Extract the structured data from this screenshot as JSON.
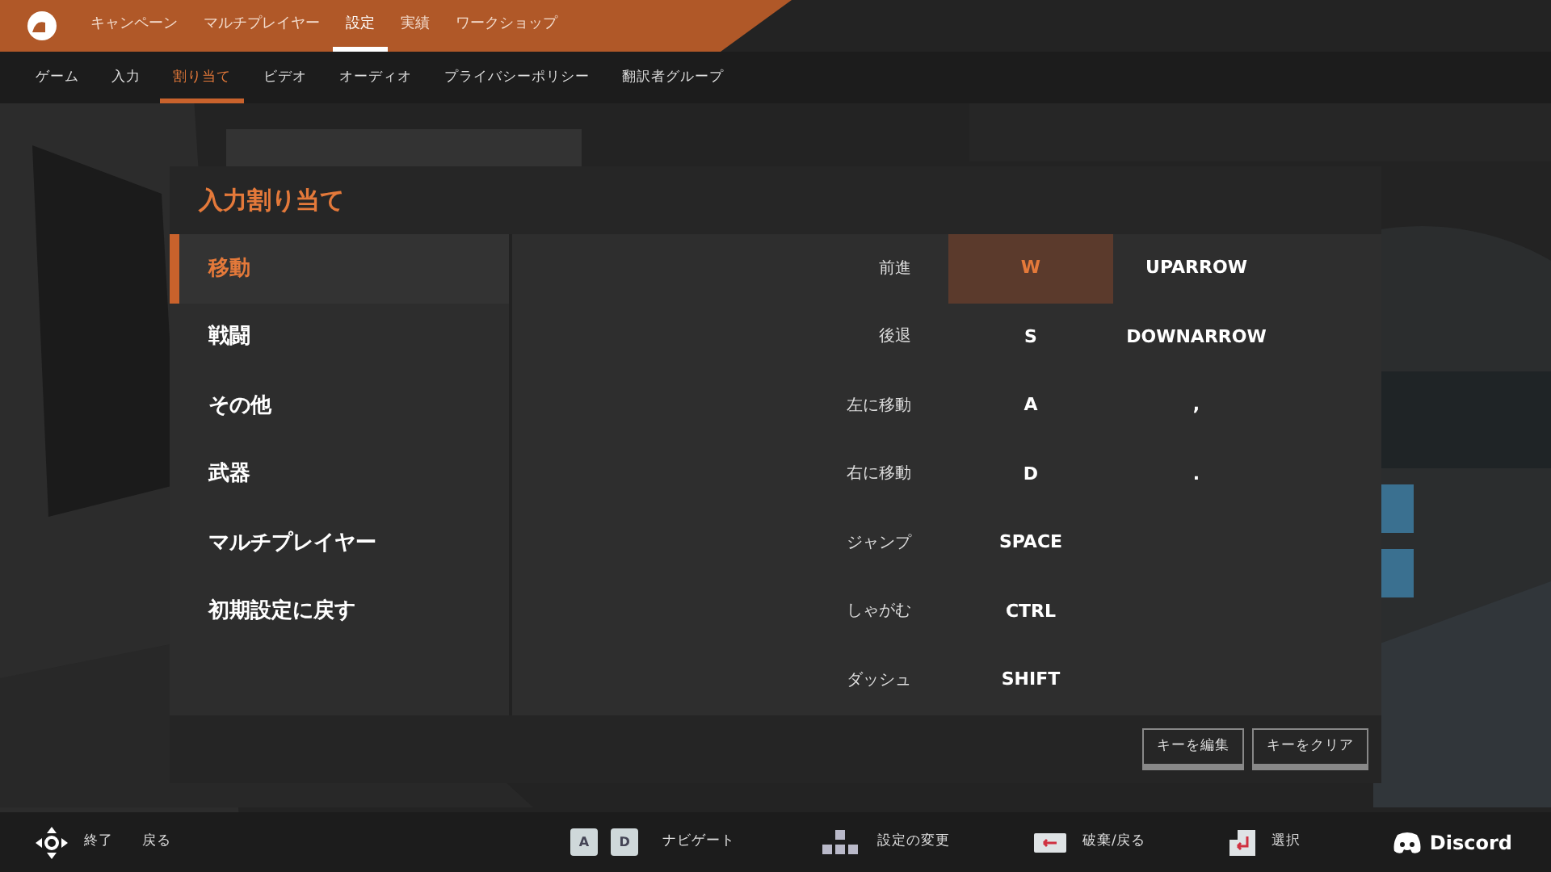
{
  "top_nav": [
    {
      "label": "キャンペーン",
      "selected": false
    },
    {
      "label": "マルチプレイヤー",
      "selected": false
    },
    {
      "label": "設定",
      "selected": true
    },
    {
      "label": "実績",
      "selected": false
    },
    {
      "label": "ワークショップ",
      "selected": false
    }
  ],
  "sub_nav": [
    {
      "label": "ゲーム",
      "selected": false
    },
    {
      "label": "入力",
      "selected": false
    },
    {
      "label": "割り当て",
      "selected": true
    },
    {
      "label": "ビデオ",
      "selected": false
    },
    {
      "label": "オーディオ",
      "selected": false
    },
    {
      "label": "プライバシーポリシー",
      "selected": false
    },
    {
      "label": "翻訳者グループ",
      "selected": false
    }
  ],
  "panel": {
    "title": "入力割り当て",
    "categories": [
      {
        "label": "移動",
        "selected": true
      },
      {
        "label": "戦闘",
        "selected": false
      },
      {
        "label": "その他",
        "selected": false
      },
      {
        "label": "武器",
        "selected": false
      },
      {
        "label": "マルチプレイヤー",
        "selected": false
      },
      {
        "label": "初期設定に戻す",
        "selected": false
      }
    ],
    "bindings": [
      {
        "action": "前進",
        "primary": "W",
        "secondary": "UPARROW",
        "selected": true
      },
      {
        "action": "後退",
        "primary": "S",
        "secondary": "DOWNARROW",
        "selected": false
      },
      {
        "action": "左に移動",
        "primary": "A",
        "secondary": ",",
        "selected": false
      },
      {
        "action": "右に移動",
        "primary": "D",
        "secondary": ".",
        "selected": false
      },
      {
        "action": "ジャンプ",
        "primary": "SPACE",
        "selected": false
      },
      {
        "action": "しゃがむ",
        "primary": "CTRL",
        "selected": false
      },
      {
        "action": "ダッシュ",
        "primary": "SHIFT",
        "selected": false
      }
    ],
    "buttons": [
      "キーを編集",
      "キーをクリア"
    ]
  },
  "footer": {
    "hints": [
      {
        "kind": "dpad",
        "label": "終了"
      },
      {
        "kind": "plain",
        "label": "戻る"
      },
      {
        "kind": "keys",
        "keys": [
          "A",
          "D"
        ],
        "label": "ナビゲート"
      },
      {
        "kind": "arrows",
        "label": "設定の変更"
      },
      {
        "kind": "backspace",
        "label": "破棄/戻る"
      },
      {
        "kind": "enter",
        "label": "選択"
      }
    ],
    "discord": "Discord"
  }
}
